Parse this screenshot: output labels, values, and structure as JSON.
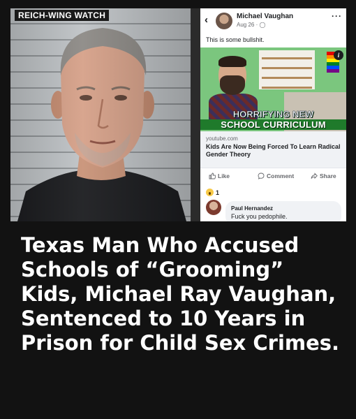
{
  "watermark": "REICH-WING WATCH",
  "post": {
    "author": "Michael Vaughan",
    "meta": "Aug 26 · ",
    "text": "This is some bullshit.",
    "thumbnail_caption_line1": "HORRIFYING NEW",
    "thumbnail_caption_line2": "SCHOOL CURRICULUM",
    "link_domain": "youtube.com",
    "link_title": "Kids Are Now Being Forced To Learn Radical Gender Theory",
    "actions": {
      "like": "Like",
      "comment": "Comment",
      "share": "Share"
    },
    "reaction_count": "1",
    "comment": {
      "author": "Paul Hernandez",
      "text": "Fuck you pedophile."
    }
  },
  "headline": "Texas Man Who Accused Schools of “Grooming” Kids, Michael Ray Vaughan, Sentenced to 10 Years in Prison for Child Sex Crimes.",
  "colors": {
    "background": "#121212",
    "headline_text": "#ffffff",
    "thumbnail_green": "#7bc67e",
    "caption_band": "#1f7a2b"
  },
  "icons": [
    "back-arrow-icon",
    "globe-icon",
    "more-dots-icon",
    "info-icon",
    "like-icon",
    "comment-icon",
    "share-icon",
    "wow-reaction-icon"
  ]
}
